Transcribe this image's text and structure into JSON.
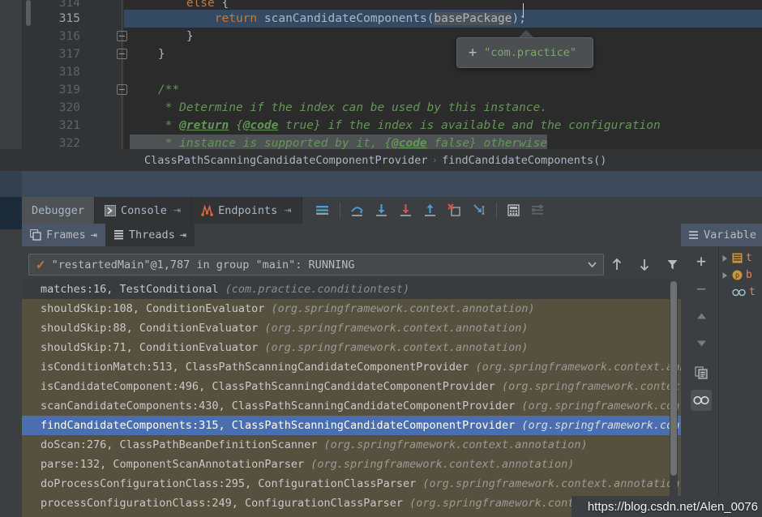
{
  "editor": {
    "breadcrumb": {
      "class": "ClassPathScanningCandidateComponentProvider",
      "separator": "›",
      "method": "findCandidateComponents()"
    },
    "lines": [
      {
        "num": "314",
        "kind": "partial",
        "segments": [
          {
            "t": "        ",
            "c": "plain"
          },
          {
            "t": "else",
            "c": "kw"
          },
          {
            "t": " {",
            "c": "plain"
          }
        ]
      },
      {
        "num": "315",
        "kind": "highlight",
        "segments": [
          {
            "t": "            ",
            "c": "plain"
          },
          {
            "t": "return",
            "c": "kw"
          },
          {
            "t": " ",
            "c": "plain"
          },
          {
            "t": "scanCandidateComponents",
            "c": "mth"
          },
          {
            "t": "(",
            "c": "plain"
          },
          {
            "t": "basePackage",
            "c": "hover"
          },
          {
            "t": ");",
            "c": "plain"
          }
        ]
      },
      {
        "num": "316",
        "kind": "fold",
        "segments": [
          {
            "t": "        }",
            "c": "plain"
          }
        ]
      },
      {
        "num": "317",
        "kind": "fold",
        "segments": [
          {
            "t": "    }",
            "c": "plain"
          }
        ]
      },
      {
        "num": "318",
        "kind": "plain",
        "segments": []
      },
      {
        "num": "319",
        "kind": "fold",
        "segments": [
          {
            "t": "    /**",
            "c": "cmt"
          }
        ]
      },
      {
        "num": "320",
        "kind": "plain",
        "segments": [
          {
            "t": "     * Determine if the index can be used by this instance.",
            "c": "cmt"
          }
        ]
      },
      {
        "num": "321",
        "kind": "plain",
        "segments": [
          {
            "t": "     * ",
            "c": "cmt"
          },
          {
            "t": "@return",
            "c": "cmt-tag"
          },
          {
            "t": " {",
            "c": "cmt"
          },
          {
            "t": "@code",
            "c": "cmt-tag"
          },
          {
            "t": " true} if the index is available and the configuration",
            "c": "cmt"
          }
        ]
      },
      {
        "num": "322",
        "kind": "dim",
        "segments": [
          {
            "t": "     * instance is supported by it, {",
            "c": "cmt"
          },
          {
            "t": "@code",
            "c": "cmt-tag"
          },
          {
            "t": " false} otherwise",
            "c": "cmt"
          }
        ]
      }
    ],
    "tooltip": {
      "plus_icon": "plus-icon",
      "value": "\"com.practice\""
    }
  },
  "debugger": {
    "tabs": [
      {
        "label": "Debugger",
        "icon": null,
        "active": true,
        "pin": ""
      },
      {
        "label": "Console",
        "icon": "console-icon",
        "active": false,
        "pin": "⇥"
      },
      {
        "label": "Endpoints",
        "icon": "endpoints-icon",
        "active": false,
        "pin": "⇥"
      }
    ],
    "toolbar": [
      {
        "name": "show-execution-point-button",
        "icon": "lines-icon"
      },
      {
        "name": "step-over-button",
        "icon": "step-over-icon"
      },
      {
        "name": "step-into-button",
        "icon": "step-into-icon"
      },
      {
        "name": "force-step-into-button",
        "icon": "force-step-into-icon"
      },
      {
        "name": "step-out-button",
        "icon": "step-out-icon"
      },
      {
        "name": "drop-frame-button",
        "icon": "drop-frame-icon"
      },
      {
        "name": "run-to-cursor-button",
        "icon": "run-to-cursor-icon"
      },
      {
        "name": "evaluate-expression-button",
        "icon": "calculator-icon"
      },
      {
        "name": "settings-button",
        "icon": "mute-breakpoints-icon"
      }
    ],
    "subtabs": [
      {
        "label": "Frames",
        "icon": "frames-icon",
        "active": true,
        "pin": "⇥"
      },
      {
        "label": "Threads",
        "icon": "threads-icon",
        "active": false,
        "pin": "⇥"
      }
    ],
    "variables_header": {
      "label": "Variable",
      "icon": "variables-icon"
    },
    "thread_selector": {
      "check_icon": "checkmark-icon",
      "value": "\"restartedMain\"@1,787 in group \"main\": RUNNING",
      "chevron_icon": "chevron-down-icon"
    },
    "frame_nav": [
      {
        "name": "frame-up-button",
        "icon": "arrow-up-icon"
      },
      {
        "name": "frame-down-button",
        "icon": "arrow-down-icon"
      },
      {
        "name": "filter-frames-button",
        "icon": "funnel-icon"
      }
    ],
    "frames": [
      {
        "method": "matches:16, TestConditional",
        "pkg": "(com.practice.conditiontest)",
        "state": "top"
      },
      {
        "method": "shouldSkip:108, ConditionEvaluator",
        "pkg": "(org.springframework.context.annotation)",
        "state": "normal"
      },
      {
        "method": "shouldSkip:88, ConditionEvaluator",
        "pkg": "(org.springframework.context.annotation)",
        "state": "normal"
      },
      {
        "method": "shouldSkip:71, ConditionEvaluator",
        "pkg": "(org.springframework.context.annotation)",
        "state": "normal"
      },
      {
        "method": "isConditionMatch:513, ClassPathScanningCandidateComponentProvider",
        "pkg": "(org.springframework.context.annotation)",
        "state": "normal"
      },
      {
        "method": "isCandidateComponent:496, ClassPathScanningCandidateComponentProvider",
        "pkg": "(org.springframework.context.annotation)",
        "state": "normal"
      },
      {
        "method": "scanCandidateComponents:430, ClassPathScanningCandidateComponentProvider",
        "pkg": "(org.springframework.context.annotation)",
        "state": "normal"
      },
      {
        "method": "findCandidateComponents:315, ClassPathScanningCandidateComponentProvider",
        "pkg": "(org.springframework.context.annotation)",
        "state": "selected"
      },
      {
        "method": "doScan:276, ClassPathBeanDefinitionScanner",
        "pkg": "(org.springframework.context.annotation)",
        "state": "normal"
      },
      {
        "method": "parse:132, ComponentScanAnnotationParser",
        "pkg": "(org.springframework.context.annotation)",
        "state": "normal"
      },
      {
        "method": "doProcessConfigurationClass:295, ConfigurationClassParser",
        "pkg": "(org.springframework.context.annotation)",
        "state": "normal"
      },
      {
        "method": "processConfigurationClass:249, ConfigurationClassParser",
        "pkg": "(org.springframework.context.annotation)",
        "state": "normal"
      }
    ],
    "variables_rail": [
      {
        "name": "add-watch-button",
        "icon": "plus-icon",
        "label": "+",
        "on": false
      },
      {
        "name": "remove-watch-button",
        "icon": "minus-icon",
        "label": "−",
        "on": false
      },
      {
        "name": "move-up-button",
        "icon": "triangle-up-icon",
        "label": "",
        "on": false
      },
      {
        "name": "move-down-button",
        "icon": "triangle-down-icon",
        "label": "",
        "on": false
      },
      {
        "name": "copy-value-button",
        "icon": "copy-icon",
        "label": "",
        "on": false
      },
      {
        "name": "inspect-button",
        "icon": "binoculars-icon",
        "label": "",
        "on": true
      }
    ],
    "variables": [
      {
        "icon": "array-icon",
        "name": "t",
        "expandable": true
      },
      {
        "icon": "parameter-icon",
        "name": "b",
        "expandable": true
      },
      {
        "icon": "binoculars-icon",
        "name": "t",
        "expandable": false
      }
    ]
  },
  "watermark": {
    "text": "https://blog.csdn.net/Alen_0076"
  },
  "colors": {
    "editor_bg": "#2b2b2b",
    "gutter_bg": "#313335",
    "panel_bg": "#3c3f41",
    "frames_bg": "#56513f",
    "selection_blue": "#4b6eaf",
    "current_line_blue": "#344a63",
    "keyword_orange": "#cc7832",
    "comment_green": "#629755",
    "text_default": "#a9b7c6",
    "tab_active": "#4a5567",
    "band_blue": "#3c4a5c",
    "variable_orange": "#e8825a"
  }
}
